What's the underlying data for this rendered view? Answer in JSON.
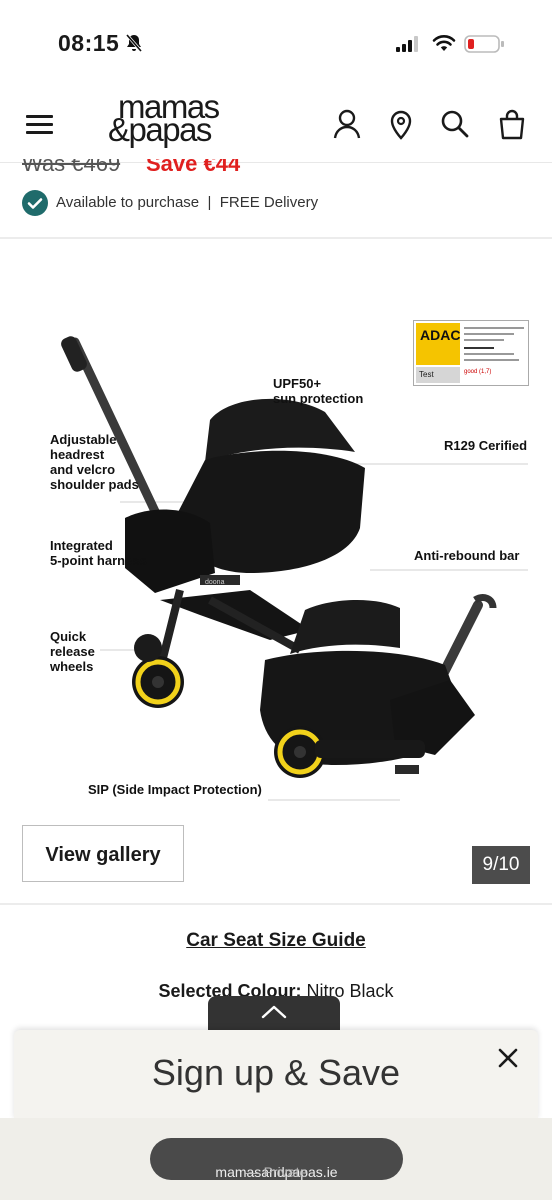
{
  "status_bar": {
    "time": "08:15",
    "bell_icon": "bell-slash-icon",
    "signal_icon": "cellular-signal-icon",
    "wifi_icon": "wifi-icon",
    "battery_icon": "battery-low-icon",
    "battery_color": "#e0201f"
  },
  "header": {
    "logo_line1": "mamas",
    "logo_line2": "&papas",
    "menu_icon": "hamburger-menu-icon",
    "icons": [
      "account-icon",
      "store-locator-icon",
      "search-icon",
      "bag-icon"
    ]
  },
  "price": {
    "was": "Was €469",
    "save": "Save €44"
  },
  "availability": {
    "text": "Available to purchase  |  FREE Delivery",
    "icon": "check-circle-icon",
    "icon_color": "#1f6b6b"
  },
  "product_image": {
    "labels": {
      "upf": "UPF50+\nsun protection",
      "headrest": "Adjustable\nheadrest\nand velcro\nshoulder pads",
      "r129": "R129 Cerified",
      "harness": "Integrated\n5-point harness",
      "antirebound": "Anti-rebound bar",
      "wheels": "Quick\nrelease\nwheels",
      "sip": "SIP (Side Impact Protection)"
    },
    "adac": {
      "brand": "ADAC",
      "test": "Test",
      "rating": "good (1,7)"
    },
    "brand_mark": "doona",
    "wheel_color": "#f2d21b"
  },
  "gallery": {
    "button": "View gallery",
    "counter": "9/10"
  },
  "size_guide": "Car Seat Size Guide",
  "colour": {
    "label": "Selected Colour:",
    "value": "Nitro Black"
  },
  "signup": {
    "title": "Sign up & Save",
    "close_icon": "close-icon",
    "toggle_icon": "chevron-up-icon"
  },
  "browser": {
    "domain": "mamasandpapas.ie",
    "mode": "— Private"
  }
}
